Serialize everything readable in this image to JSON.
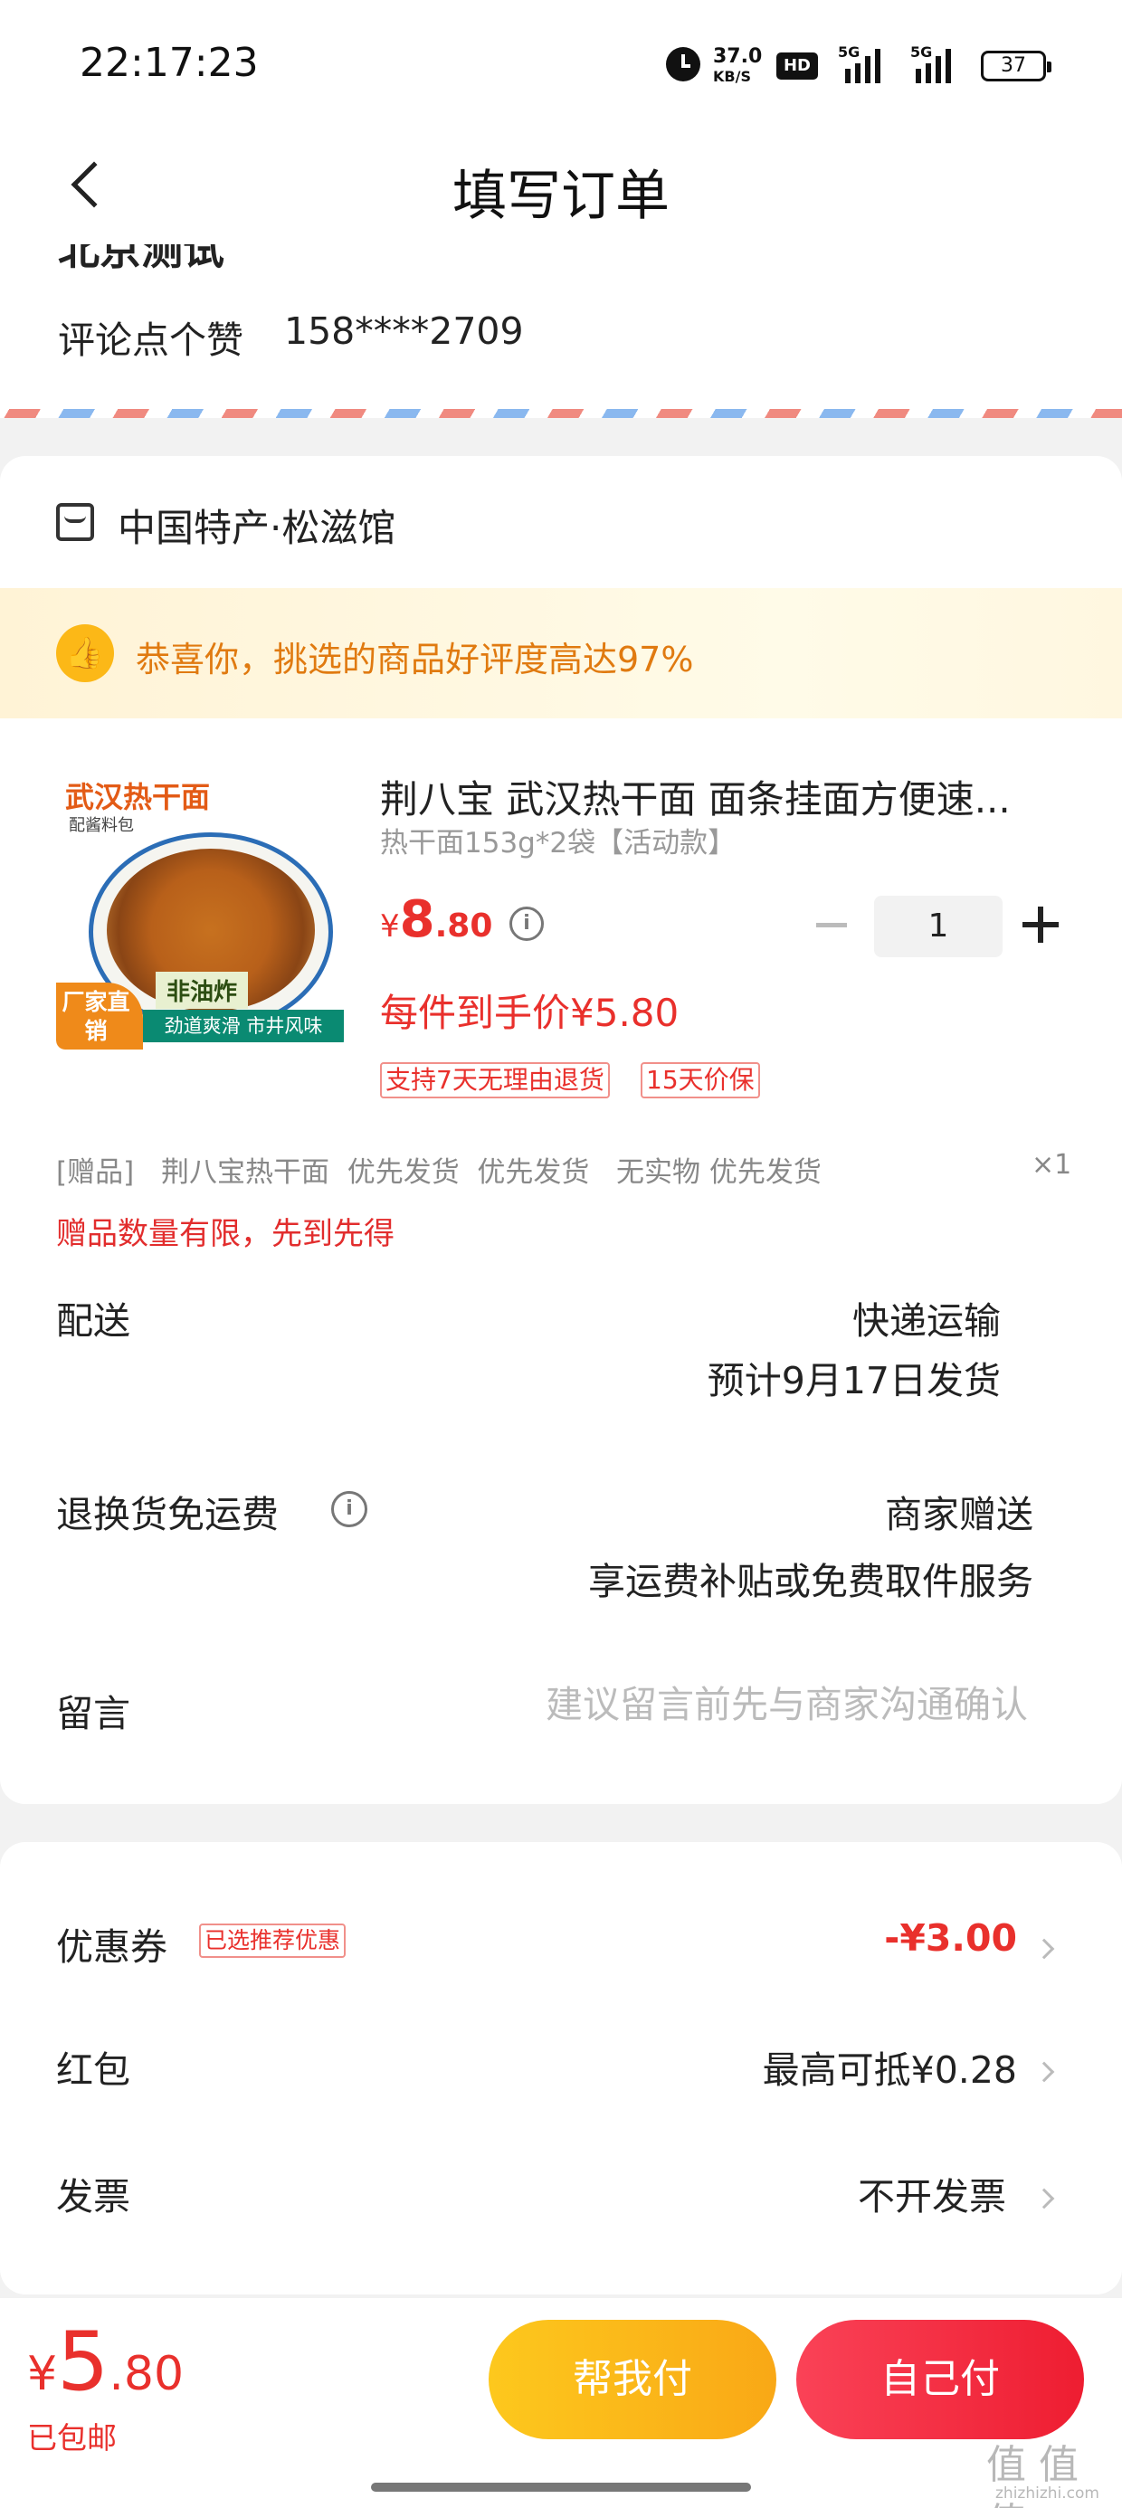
{
  "status_bar": {
    "time": "22:17:23",
    "net_speed_value": "37.0",
    "net_speed_unit": "KB/S",
    "hd": "HD",
    "signal_1": "5G",
    "signal_2": "5G",
    "battery": "37"
  },
  "header": {
    "title": "填写订单"
  },
  "address": {
    "partial_line": "北京测试",
    "name": "评论点个赞",
    "phone": "158****2709"
  },
  "store": {
    "name": "中国特产·松滋馆",
    "banner": "恭喜你，挑选的商品好评度高达97%"
  },
  "product": {
    "thumb_title": "武汉热干面",
    "thumb_sub": "配酱料包",
    "thumb_tag_1": "非油炸",
    "thumb_tag_2": "劲道爽滑 市井风味",
    "thumb_badge": "厂家直销",
    "title": "荆八宝 武汉热干面 面条挂面方便速...",
    "spec": "热干面153g*2袋【活动款】",
    "price_currency": "¥",
    "price_int": "8",
    "price_dec": ".80",
    "quantity": "1",
    "unit_price": "每件到手价¥5.80",
    "tag_1": "支持7天无理由退货",
    "tag_2": "15天价保"
  },
  "gift": {
    "prefix": "[赠品]",
    "text": "荆八宝热干面  优先发货  优先发货   无实物 优先发货",
    "count": "×1",
    "note": "赠品数量有限，先到先得"
  },
  "delivery": {
    "label": "配送",
    "method": "快递运输",
    "eta": "预计9月17日发货"
  },
  "return_fee": {
    "label": "退换货免运费",
    "value": "商家赠送",
    "desc": "享运费补贴或免费取件服务"
  },
  "message": {
    "label": "留言",
    "placeholder": "建议留言前先与商家沟通确认"
  },
  "discounts": {
    "coupon_label": "优惠券",
    "coupon_badge": "已选推荐优惠",
    "coupon_value": "-¥3.00",
    "redpacket_label": "红包",
    "redpacket_value": "最高可抵¥0.28",
    "invoice_label": "发票",
    "invoice_value": "不开发票"
  },
  "footer": {
    "currency": "¥",
    "total_int": "5",
    "total_dec": ".80",
    "shipping": "已包邮",
    "help_pay": "帮我付",
    "self_pay": "自己付"
  },
  "watermark": {
    "text": "值 值 值",
    "url": "zhizhizhi.com"
  },
  "colors": {
    "accent_red": "#e22d2d",
    "price_red": "#e9302c",
    "yellow_button": "#fcc219",
    "red_button": "#f33046",
    "banner_orange": "#e07a10"
  }
}
